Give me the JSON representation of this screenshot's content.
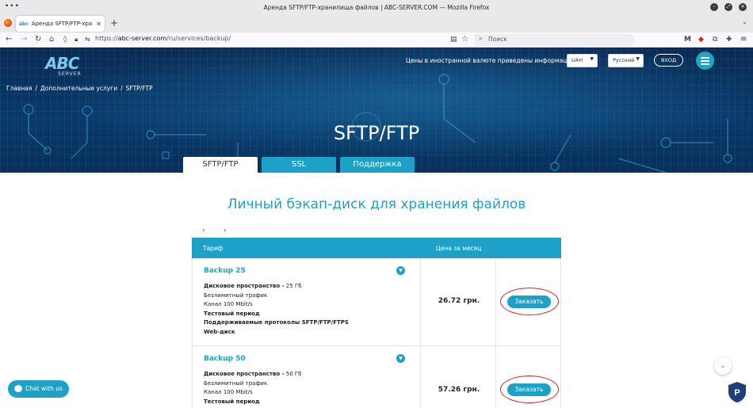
{
  "browser": {
    "window_title": "Аренда SFTP/FTP-хранилища файлов | ABC-SERVER.COM — Mozilla Firefox",
    "tab_title": "Аренда SFTP/FTP-хранилища",
    "tab_favicon": "abc",
    "url_host": "abc-server.com",
    "url_path": "/ru/services/backup/",
    "url_prefix": "https://",
    "search_placeholder": "Поиск",
    "menu_dots": "•••"
  },
  "header": {
    "logo_text": "ABC",
    "logo_sub": "SERVER",
    "currency_note": "Цены в иностранной валюте приведены информационно",
    "currency_value": "UAH",
    "language_value": "Русский",
    "login_label": "ВХОД",
    "breadcrumb": [
      "Главная",
      "/",
      "Дополнительные услуги",
      "/",
      "SFTP/FTP"
    ],
    "hero_title": "SFTP/FTP"
  },
  "page_tabs": [
    {
      "label": "SFTP/FTP",
      "active": true
    },
    {
      "label": "SSL",
      "active": false
    },
    {
      "label": "Поддержка",
      "active": false
    }
  ],
  "main": {
    "heading": "Личный бэкап-диск для хранения файлов",
    "pager_prev": "‹",
    "pager_next": "›",
    "table": {
      "col_tariff": "Тариф",
      "col_price": "Цена за месяц",
      "rows": [
        {
          "name": "Backup 25",
          "disk_label": "Дисковое пространство -",
          "disk_value": "25 Гб",
          "features": [
            "Безлимитный трафик",
            "Канал 100 Mbit/s"
          ],
          "bold_features": [
            "Тестовый период",
            "Поддерживаемые протоколы SFTP/FTP/FTPS",
            "Web-диск"
          ],
          "price": "26.72 грн.",
          "order_label": "Заказать"
        },
        {
          "name": "Backup 50",
          "disk_label": "Дисковое пространство -",
          "disk_value": "50 Гб",
          "features": [
            "Безлимитный трафик",
            "Канал 100 Mbit/s"
          ],
          "bold_features": [
            "Тестовый период"
          ],
          "price": "57.26 грн.",
          "order_label": "Заказать"
        }
      ]
    }
  },
  "widgets": {
    "chat_label": "Chat with us"
  },
  "colors": {
    "accent": "#1ea1c6",
    "hero_bg": "#0a3a6a",
    "highlight_ring": "#d82020"
  }
}
